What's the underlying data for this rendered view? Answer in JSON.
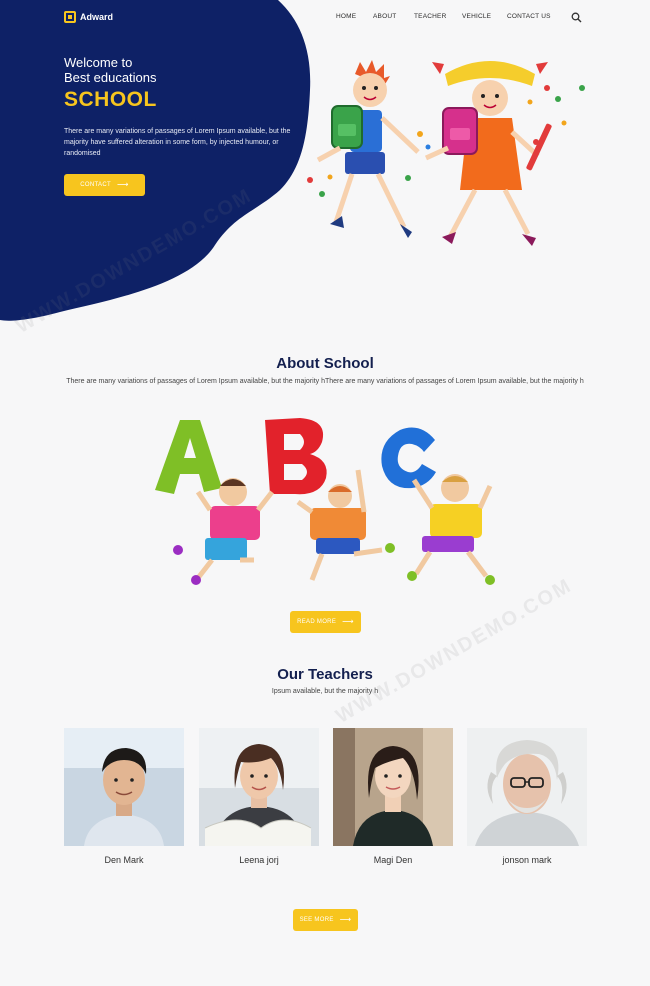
{
  "brand": {
    "logo_text": "Adward",
    "accent": "#f7c51e",
    "navy": "#0e2166"
  },
  "nav": {
    "items": [
      "HOME",
      "ABOUT",
      "TEACHER",
      "VEHICLE",
      "CONTACT US"
    ],
    "search_icon": "search-icon"
  },
  "hero": {
    "welcome_line1": "Welcome to",
    "welcome_line2": "Best educations",
    "headline": "SCHOOL",
    "description": "There are many variations of passages of Lorem Ipsum available, but the majority have suffered alteration in some form, by injected humour, or randomised",
    "cta_label": "CONTACT"
  },
  "about": {
    "title": "About School",
    "description": "There are many variations of passages of Lorem Ipsum available, but the majority hThere are many variations of passages of Lorem Ipsum available, but the majority h",
    "button_label": "READ MORE"
  },
  "teachers": {
    "title": "Our Teachers",
    "subtitle": "Ipsum available, but the majority h",
    "people": [
      {
        "name": "Den Mark"
      },
      {
        "name": "Leena jorj"
      },
      {
        "name": "Magi Den"
      },
      {
        "name": "jonson mark"
      }
    ],
    "button_label": "SEE MORE"
  },
  "watermark": "WWW.DOWNDEMO.COM"
}
